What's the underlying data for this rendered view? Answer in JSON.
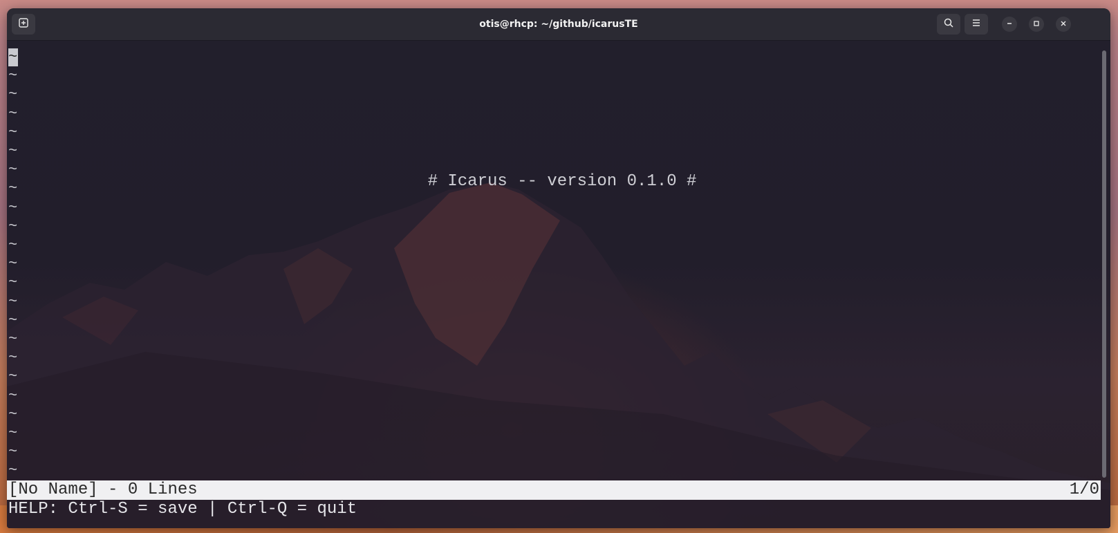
{
  "window": {
    "title": "otis@rhcp: ~/github/icarusTE"
  },
  "titlebar": {
    "new_tab_icon": "new-tab-icon",
    "search_icon": "search-icon",
    "menu_icon": "hamburger-menu-icon",
    "minimize_icon": "minimize-icon",
    "maximize_icon": "maximize-icon",
    "close_icon": "close-icon"
  },
  "editor": {
    "empty_line_marker": "~",
    "line_count_visible": 23,
    "welcome": "# Icarus -- version 0.1.0 #"
  },
  "status": {
    "left": "[No Name] - 0 Lines",
    "right": "1/0"
  },
  "help": {
    "text": "HELP: Ctrl-S = save | Ctrl-Q = quit"
  },
  "colors": {
    "titlebar": "#2b2a33",
    "terminal_bg": "#221f2c",
    "status_bg": "#f0f0f2"
  }
}
